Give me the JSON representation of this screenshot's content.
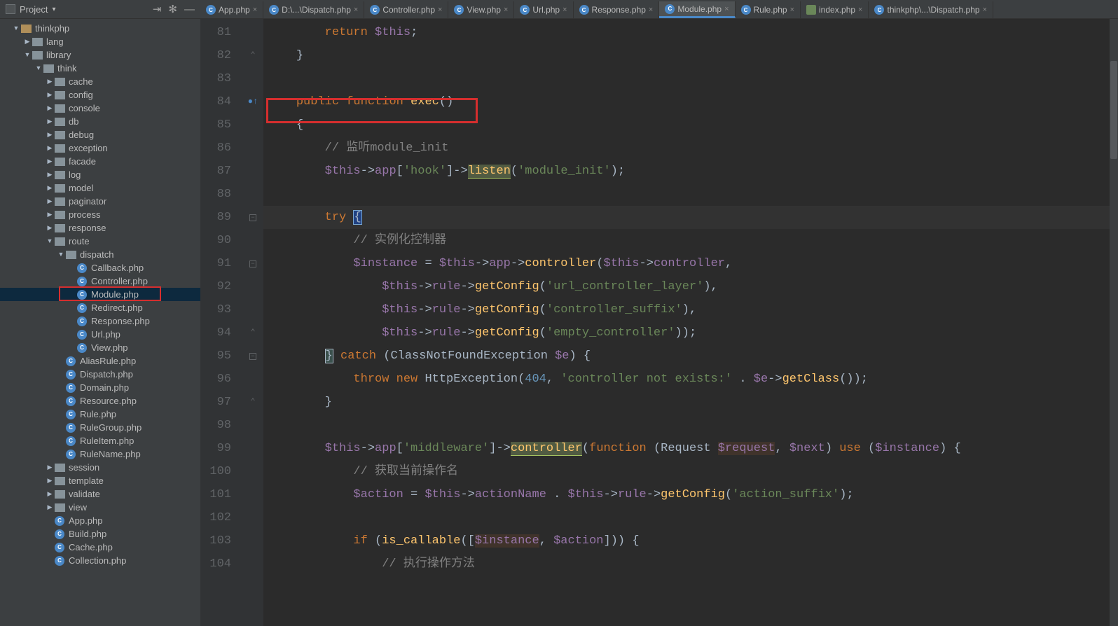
{
  "header": {
    "project_label": "Project",
    "actions": {
      "target": "⇥",
      "gear": "✻",
      "hide": "—"
    }
  },
  "tabs": [
    {
      "label": "App.php",
      "icon": "php"
    },
    {
      "label": "D:\\...\\Dispatch.php",
      "icon": "php"
    },
    {
      "label": "Controller.php",
      "icon": "php"
    },
    {
      "label": "View.php",
      "icon": "php"
    },
    {
      "label": "Url.php",
      "icon": "php"
    },
    {
      "label": "Response.php",
      "icon": "php"
    },
    {
      "label": "Module.php",
      "icon": "php",
      "active": true
    },
    {
      "label": "Rule.php",
      "icon": "php"
    },
    {
      "label": "index.php",
      "icon": "twig"
    },
    {
      "label": "thinkphp\\...\\Dispatch.php",
      "icon": "php"
    }
  ],
  "tree": [
    {
      "indent": 1,
      "caret": "▼",
      "type": "dir-root",
      "label": "thinkphp"
    },
    {
      "indent": 2,
      "caret": "▶",
      "type": "dir",
      "label": "lang"
    },
    {
      "indent": 2,
      "caret": "▼",
      "type": "dir",
      "label": "library"
    },
    {
      "indent": 3,
      "caret": "▼",
      "type": "dir",
      "label": "think"
    },
    {
      "indent": 4,
      "caret": "▶",
      "type": "dir",
      "label": "cache"
    },
    {
      "indent": 4,
      "caret": "▶",
      "type": "dir",
      "label": "config"
    },
    {
      "indent": 4,
      "caret": "▶",
      "type": "dir",
      "label": "console"
    },
    {
      "indent": 4,
      "caret": "▶",
      "type": "dir",
      "label": "db"
    },
    {
      "indent": 4,
      "caret": "▶",
      "type": "dir",
      "label": "debug"
    },
    {
      "indent": 4,
      "caret": "▶",
      "type": "dir",
      "label": "exception"
    },
    {
      "indent": 4,
      "caret": "▶",
      "type": "dir",
      "label": "facade"
    },
    {
      "indent": 4,
      "caret": "▶",
      "type": "dir",
      "label": "log"
    },
    {
      "indent": 4,
      "caret": "▶",
      "type": "dir",
      "label": "model"
    },
    {
      "indent": 4,
      "caret": "▶",
      "type": "dir",
      "label": "paginator"
    },
    {
      "indent": 4,
      "caret": "▶",
      "type": "dir",
      "label": "process"
    },
    {
      "indent": 4,
      "caret": "▶",
      "type": "dir",
      "label": "response"
    },
    {
      "indent": 4,
      "caret": "▼",
      "type": "dir",
      "label": "route"
    },
    {
      "indent": 5,
      "caret": "▼",
      "type": "dir",
      "label": "dispatch"
    },
    {
      "indent": 6,
      "caret": "",
      "type": "php",
      "label": "Callback.php"
    },
    {
      "indent": 6,
      "caret": "",
      "type": "php",
      "label": "Controller.php"
    },
    {
      "indent": 6,
      "caret": "",
      "type": "php",
      "label": "Module.php",
      "selected": true,
      "box": true
    },
    {
      "indent": 6,
      "caret": "",
      "type": "php",
      "label": "Redirect.php"
    },
    {
      "indent": 6,
      "caret": "",
      "type": "php",
      "label": "Response.php"
    },
    {
      "indent": 6,
      "caret": "",
      "type": "php",
      "label": "Url.php"
    },
    {
      "indent": 6,
      "caret": "",
      "type": "php",
      "label": "View.php"
    },
    {
      "indent": 5,
      "caret": "",
      "type": "php",
      "label": "AliasRule.php"
    },
    {
      "indent": 5,
      "caret": "",
      "type": "php",
      "label": "Dispatch.php"
    },
    {
      "indent": 5,
      "caret": "",
      "type": "php",
      "label": "Domain.php"
    },
    {
      "indent": 5,
      "caret": "",
      "type": "php",
      "label": "Resource.php"
    },
    {
      "indent": 5,
      "caret": "",
      "type": "php",
      "label": "Rule.php"
    },
    {
      "indent": 5,
      "caret": "",
      "type": "php",
      "label": "RuleGroup.php"
    },
    {
      "indent": 5,
      "caret": "",
      "type": "php",
      "label": "RuleItem.php"
    },
    {
      "indent": 5,
      "caret": "",
      "type": "php",
      "label": "RuleName.php"
    },
    {
      "indent": 4,
      "caret": "▶",
      "type": "dir",
      "label": "session"
    },
    {
      "indent": 4,
      "caret": "▶",
      "type": "dir",
      "label": "template"
    },
    {
      "indent": 4,
      "caret": "▶",
      "type": "dir",
      "label": "validate"
    },
    {
      "indent": 4,
      "caret": "▶",
      "type": "dir",
      "label": "view"
    },
    {
      "indent": 4,
      "caret": "",
      "type": "php",
      "label": "App.php"
    },
    {
      "indent": 4,
      "caret": "",
      "type": "php",
      "label": "Build.php"
    },
    {
      "indent": 4,
      "caret": "",
      "type": "php",
      "label": "Cache.php"
    },
    {
      "indent": 4,
      "caret": "",
      "type": "php",
      "label": "Collection.php"
    }
  ],
  "line_numbers": [
    81,
    82,
    83,
    84,
    85,
    86,
    87,
    88,
    89,
    90,
    91,
    92,
    93,
    94,
    95,
    96,
    97,
    98,
    99,
    100,
    101,
    102,
    103,
    104
  ],
  "gutter_marks": {
    "82": "fold-end",
    "84": "override",
    "89": "fold-start",
    "91": "fold-start",
    "94": "fold-end",
    "95": "fold-start",
    "97": "fold-end"
  },
  "current_line": 89,
  "code": {
    "l81": {
      "pre": "        ",
      "k": "return",
      "sp": " ",
      "var": "$this",
      "post": ";"
    },
    "l82": {
      "pre": "    ",
      "txt": "}"
    },
    "l83": {
      "txt": ""
    },
    "l84": {
      "pre": "    ",
      "k1": "public",
      "sp1": " ",
      "k2": "function",
      "sp2": " ",
      "fn": "exec",
      "post": "()"
    },
    "l85": {
      "pre": "    ",
      "txt": "{"
    },
    "l86": {
      "pre": "        ",
      "c": "// 监听module_init"
    },
    "l87": {
      "pre": "        ",
      "var": "$this",
      "arrow": "->",
      "prop": "app",
      "br": "[",
      "s": "'hook'",
      "br2": "]->",
      "fn": "listen",
      "lp": "(",
      "s2": "'module_init'",
      "rp": ");"
    },
    "l88": {
      "txt": ""
    },
    "l89": {
      "pre": "        ",
      "k": "try",
      "sp": " ",
      "brace": "{"
    },
    "l90": {
      "pre": "            ",
      "c": "// 实例化控制器"
    },
    "l91": {
      "pre": "            ",
      "var": "$instance",
      "eq": " = ",
      "var2": "$this",
      "p": "->",
      "prop": "app",
      "p2": "->",
      "fn": "controller",
      "lp": "(",
      "var3": "$this",
      "p3": "->",
      "prop2": "controller",
      "post": ","
    },
    "l92": {
      "pre": "                ",
      "var": "$this",
      "p": "->",
      "prop": "rule",
      "p2": "->",
      "fn": "getConfig",
      "lp": "(",
      "s": "'url_controller_layer'",
      "rp": "),"
    },
    "l93": {
      "pre": "                ",
      "var": "$this",
      "p": "->",
      "prop": "rule",
      "p2": "->",
      "fn": "getConfig",
      "lp": "(",
      "s": "'controller_suffix'",
      "rp": "),"
    },
    "l94": {
      "pre": "                ",
      "var": "$this",
      "p": "->",
      "prop": "rule",
      "p2": "->",
      "fn": "getConfig",
      "lp": "(",
      "s": "'empty_controller'",
      "rp": "));"
    },
    "l95": {
      "pre": "        ",
      "brace": "}",
      "sp": " ",
      "k": "catch",
      "sp2": " (",
      "cls": "ClassNotFoundException ",
      "var": "$e",
      "rp": ") {"
    },
    "l96": {
      "pre": "            ",
      "k": "throw",
      "sp": " ",
      "k2": "new",
      "sp2": " ",
      "cls": "HttpException",
      "lp": "(",
      "n": "404",
      "com": ", ",
      "s": "'controller not exists:'",
      "dot": " . ",
      "var": "$e",
      "p": "->",
      "fn": "getClass",
      "rp": "());"
    },
    "l97": {
      "pre": "        ",
      "txt": "}"
    },
    "l98": {
      "txt": ""
    },
    "l99": {
      "pre": "        ",
      "var": "$this",
      "p": "->",
      "prop": "app",
      "br": "[",
      "s": "'middleware'",
      "br2": "]->",
      "fn": "controller",
      "lp": "(",
      "k": "function",
      "sp": " (",
      "cls": "Request ",
      "var2": "$request",
      "com": ", ",
      "var3": "$next",
      "rp": ") ",
      "k2": "use",
      "sp2": " (",
      "var4": "$instance",
      "rp2": ") {"
    },
    "l100": {
      "pre": "            ",
      "c": "// 获取当前操作名"
    },
    "l101": {
      "pre": "            ",
      "var": "$action",
      "eq": " = ",
      "var2": "$this",
      "p": "->",
      "prop": "actionName",
      "dot": " . ",
      "var3": "$this",
      "p2": "->",
      "prop2": "rule",
      "p3": "->",
      "fn": "getConfig",
      "lp": "(",
      "s": "'action_suffix'",
      "rp": ");"
    },
    "l102": {
      "txt": ""
    },
    "l103": {
      "pre": "            ",
      "k": "if",
      "sp": " (",
      "fn": "is_callable",
      "lp": "([",
      "var": "$instance",
      "com": ", ",
      "var2": "$action",
      "rp": "])) {"
    },
    "l104": {
      "pre": "                ",
      "c": "// 执行操作方法"
    }
  }
}
